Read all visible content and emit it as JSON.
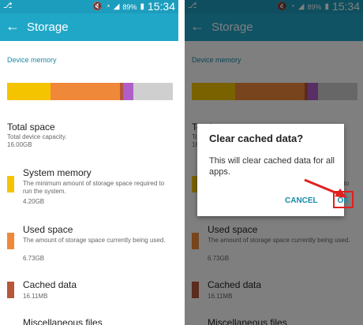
{
  "status_bar": {
    "left_icon": "⎇",
    "battery_text": "89%",
    "time": "15:34"
  },
  "app_bar": {
    "title": "Storage",
    "back_icon": "←"
  },
  "section_label": "Device memory",
  "usage_bar": {
    "segments": [
      {
        "name": "system",
        "fraction": 0.26,
        "color": "#f5c400"
      },
      {
        "name": "used",
        "fraction": 0.42,
        "color": "#f0883a"
      },
      {
        "name": "cached",
        "fraction": 0.02,
        "color": "#b6573a"
      },
      {
        "name": "misc",
        "fraction": 0.06,
        "color": "#b05fc8"
      },
      {
        "name": "free",
        "fraction": 0.24,
        "color": "#cfcfcf"
      }
    ]
  },
  "total": {
    "title": "Total space",
    "desc": "Total device capacity.",
    "value": "16.00GB"
  },
  "items": [
    {
      "title": "System memory",
      "desc": "The minimum amount of storage space required to run the system.",
      "value": "4.20GB",
      "color": "#f5c400"
    },
    {
      "title": "Used space",
      "desc": "The amount of storage space currently being used.",
      "value": "6.73GB",
      "color": "#f0883a"
    },
    {
      "title": "Cached data",
      "desc": "",
      "value": "16.11MB",
      "color": "#b6573a"
    },
    {
      "title": "Miscellaneous files",
      "desc": "",
      "value": "",
      "color": "#b05fc8"
    }
  ],
  "dialog": {
    "title": "Clear cached data?",
    "message": "This will clear cached data for all apps.",
    "cancel_label": "CANCEL",
    "ok_label": "OK"
  }
}
